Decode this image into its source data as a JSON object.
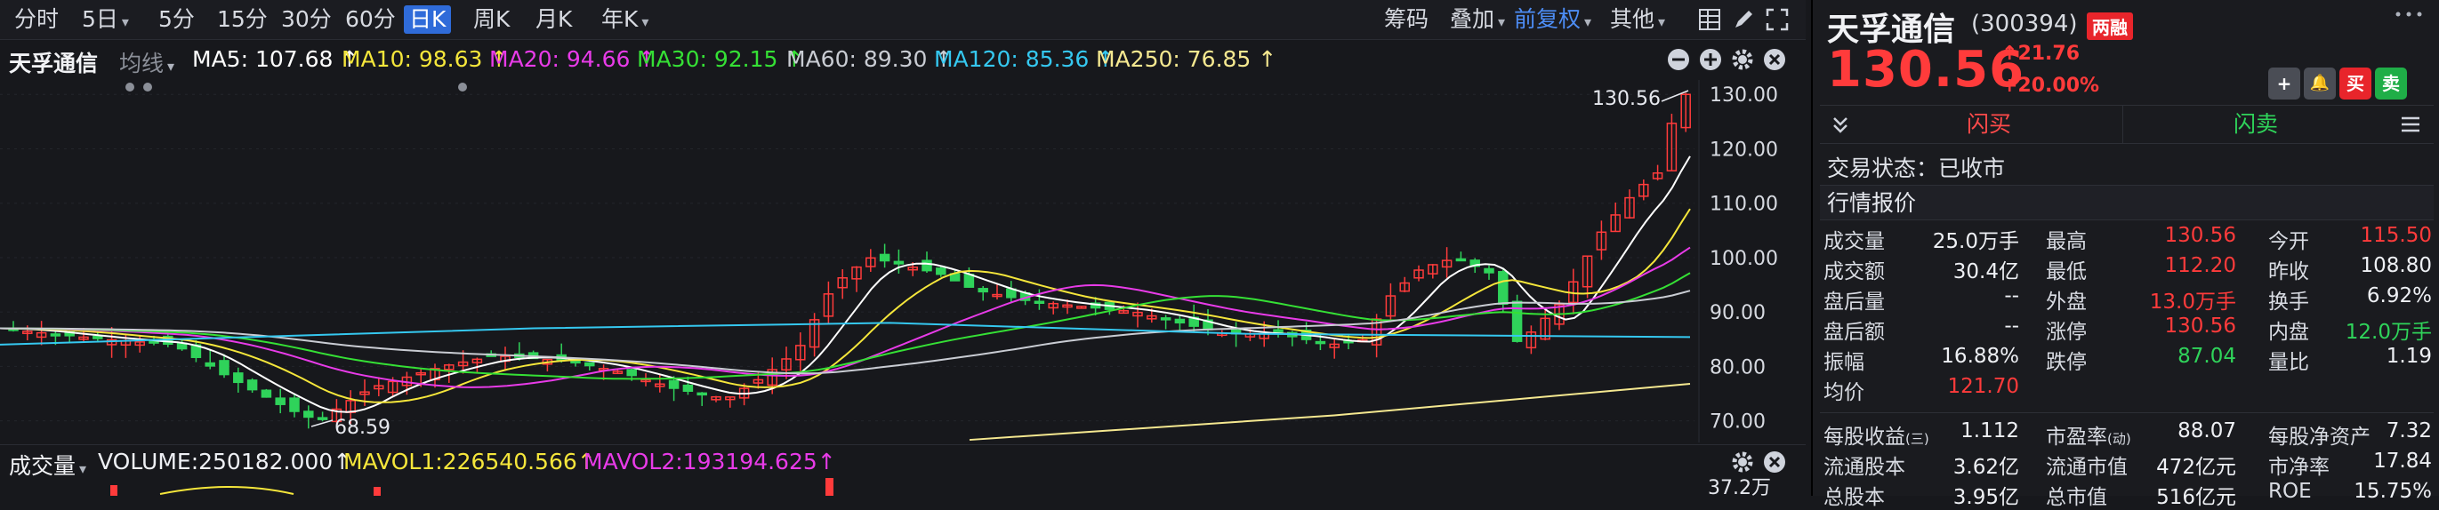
{
  "toolbar": {
    "periods": [
      "分时",
      "5日",
      "5分",
      "15分",
      "30分",
      "60分",
      "日K",
      "周K",
      "月K",
      "年K"
    ],
    "active_period": "日K",
    "right_items": [
      "筹码",
      "叠加",
      "前复权",
      "其他"
    ]
  },
  "indicator": {
    "stock_name": "天孚通信",
    "mode": "均线",
    "ma": [
      {
        "label": "MA5: 107.68 ↑",
        "color": "#ffffff"
      },
      {
        "label": "MA10: 98.63 ↑",
        "color": "#f5e63b"
      },
      {
        "label": "MA20: 94.66 ↑",
        "color": "#e83be8"
      },
      {
        "label": "MA30: 92.15 ↑",
        "color": "#35e035"
      },
      {
        "label": "MA60: 89.30 ↑",
        "color": "#c9ccd3"
      },
      {
        "label": "MA120: 85.36 ↑",
        "color": "#35c8f0"
      },
      {
        "label": "MA250: 76.85 ↑",
        "color": "#f5e890"
      }
    ]
  },
  "main_chart": {
    "y_ticks": [
      "130.00",
      "120.00",
      "110.00",
      "100.00",
      "90.00",
      "80.00",
      "70.00"
    ],
    "high_label": "130.56",
    "low_label": "68.59"
  },
  "volume": {
    "title": "成交量",
    "volume_label": "VOLUME:250182.000↑",
    "mavol1_label": "MAVOL1:226540.566↑",
    "mavol2_label": "MAVOL2:193194.625↑",
    "axis_label": "37.2万"
  },
  "panel": {
    "name": "天孚通信",
    "code": "(300394)",
    "badge": "两融",
    "price": "130.56",
    "change": "21.76",
    "change_pct": "+20.00%",
    "buttons": [
      "+",
      "🔔",
      "买",
      "卖"
    ],
    "flash_buy": "闪买",
    "flash_sell": "闪卖",
    "status": "交易状态：已收市",
    "section": "行情报价",
    "quotes": [
      [
        {
          "label": "成交量",
          "value": "25.0万手",
          "cls": "white"
        },
        {
          "label": "最高",
          "value": "130.56",
          "cls": "red"
        },
        {
          "label": "今开",
          "value": "115.50",
          "cls": "red"
        }
      ],
      [
        {
          "label": "成交额",
          "value": "30.4亿",
          "cls": "white"
        },
        {
          "label": "最低",
          "value": "112.20",
          "cls": "red"
        },
        {
          "label": "昨收",
          "value": "108.80",
          "cls": "white"
        }
      ],
      [
        {
          "label": "盘后量",
          "value": "--",
          "cls": "white"
        },
        {
          "label": "外盘",
          "value": "13.0万手",
          "cls": "red"
        },
        {
          "label": "换手",
          "value": "6.92%",
          "cls": "white"
        }
      ],
      [
        {
          "label": "盘后额",
          "value": "--",
          "cls": "white"
        },
        {
          "label": "涨停",
          "value": "130.56",
          "cls": "red"
        },
        {
          "label": "内盘",
          "value": "12.0万手",
          "cls": "green"
        }
      ],
      [
        {
          "label": "振幅",
          "value": "16.88%",
          "cls": "white"
        },
        {
          "label": "跌停",
          "value": "87.04",
          "cls": "green"
        },
        {
          "label": "量比",
          "value": "1.19",
          "cls": "white"
        }
      ],
      [
        {
          "label": "均价",
          "value": "121.70",
          "cls": "red"
        },
        {
          "label": "",
          "value": "",
          "cls": "white"
        },
        {
          "label": "",
          "value": "",
          "cls": "white"
        }
      ]
    ],
    "fundamentals": [
      [
        {
          "label": "每股收益",
          "sub": "(三)",
          "value": "1.112"
        },
        {
          "label": "市盈率",
          "sub": "(动)",
          "value": "88.07"
        },
        {
          "label": "每股净资产",
          "sub": "",
          "value": "7.32"
        }
      ],
      [
        {
          "label": "流通股本",
          "sub": "",
          "value": "3.62亿"
        },
        {
          "label": "流通市值",
          "sub": "",
          "value": "472亿元"
        },
        {
          "label": "市净率",
          "sub": "",
          "value": "17.84"
        }
      ],
      [
        {
          "label": "总股本",
          "sub": "",
          "value": "3.95亿"
        },
        {
          "label": "总市值",
          "sub": "",
          "value": "516亿元"
        },
        {
          "label": "ROE",
          "sub": "",
          "value": "15.75%"
        }
      ]
    ]
  },
  "colors": {
    "up": "#ff3b3b",
    "down": "#2fd35a",
    "accent": "#2f6bd9"
  }
}
